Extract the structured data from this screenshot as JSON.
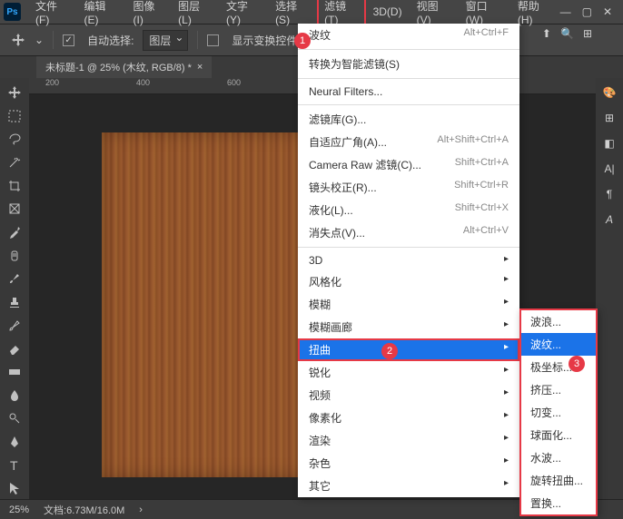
{
  "app_icon_text": "Ps",
  "menubar": [
    "文件(F)",
    "编辑(E)",
    "图像(I)",
    "图层(L)",
    "文字(Y)",
    "选择(S)",
    "滤镜(T)",
    "3D(D)",
    "视图(V)",
    "窗口(W)",
    "帮助(H)"
  ],
  "menubar_active_index": 6,
  "toolbar": {
    "auto_select": "自动选择:",
    "layer_dd": "图层",
    "transform_ctrls": "显示变换控件"
  },
  "tab": {
    "title": "未标题-1 @ 25% (木纹, RGB/8) *"
  },
  "ruler_marks": [
    "200",
    "400",
    "600"
  ],
  "status": {
    "zoom": "25%",
    "doc": "文档:6.73M/16.0M"
  },
  "filter_menu": {
    "recent": {
      "label": "波纹",
      "shortcut": "Alt+Ctrl+F"
    },
    "smart": "转换为智能滤镜(S)",
    "neural": "Neural Filters...",
    "library": "滤镜库(G)...",
    "adaptive": {
      "label": "自适应广角(A)...",
      "shortcut": "Alt+Shift+Ctrl+A"
    },
    "camera": {
      "label": "Camera Raw 滤镜(C)...",
      "shortcut": "Shift+Ctrl+A"
    },
    "lens": {
      "label": "镜头校正(R)...",
      "shortcut": "Shift+Ctrl+R"
    },
    "liquify": {
      "label": "液化(L)...",
      "shortcut": "Shift+Ctrl+X"
    },
    "vanish": {
      "label": "消失点(V)...",
      "shortcut": "Alt+Ctrl+V"
    },
    "subs": [
      "3D",
      "风格化",
      "模糊",
      "模糊画廊",
      "扭曲",
      "锐化",
      "视频",
      "像素化",
      "渲染",
      "杂色",
      "其它"
    ]
  },
  "distort_submenu": [
    "波浪...",
    "波纹...",
    "极坐标...",
    "挤压...",
    "切变...",
    "球面化...",
    "水波...",
    "旋转扭曲...",
    "置换..."
  ],
  "distort_hl_index": 1,
  "badges": {
    "b1": "1",
    "b2": "2",
    "b3": "3"
  }
}
